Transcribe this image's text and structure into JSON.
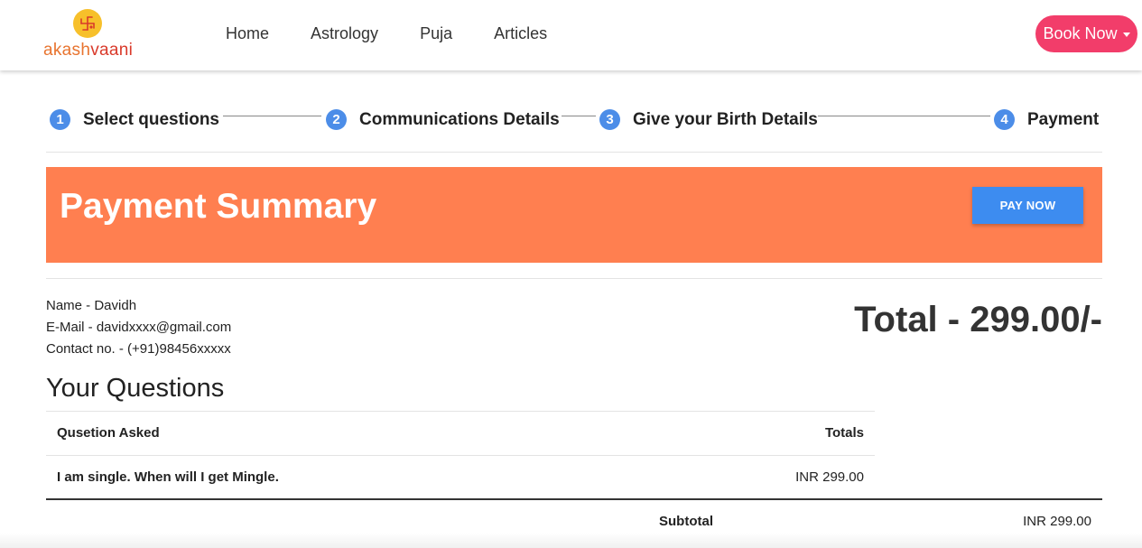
{
  "header": {
    "logo_text_a": "akash",
    "logo_text_b": "vaani",
    "nav": [
      "Home",
      "Astrology",
      "Puja",
      "Articles"
    ],
    "book_label": "Book Now"
  },
  "steps": [
    {
      "num": "1",
      "label": "Select questions"
    },
    {
      "num": "2",
      "label": "Communications Details"
    },
    {
      "num": "3",
      "label": "Give your Birth Details"
    },
    {
      "num": "4",
      "label": "Payment"
    }
  ],
  "banner": {
    "title": "Payment Summary",
    "pay_label": "PAY NOW"
  },
  "customer": {
    "name": "Name - Davidh",
    "email": "E-Mail - davidxxxx@gmail.com",
    "contact": "Contact no. - (+91)98456xxxxx"
  },
  "total": "Total - 299.00/-",
  "questions": {
    "title": "Your Questions",
    "col_question": "Qusetion Asked",
    "col_totals": "Totals",
    "rows": [
      {
        "question": "I am single. When will I get Mingle.",
        "total": "INR 299.00"
      }
    ],
    "subtotal_label": "Subtotal",
    "subtotal_value": "INR 299.00"
  },
  "colors": {
    "banner": "#ff7f50",
    "pay_button": "#3d8cf0",
    "book_button": "#f23d6a",
    "step_badge": "#4c8de8"
  }
}
